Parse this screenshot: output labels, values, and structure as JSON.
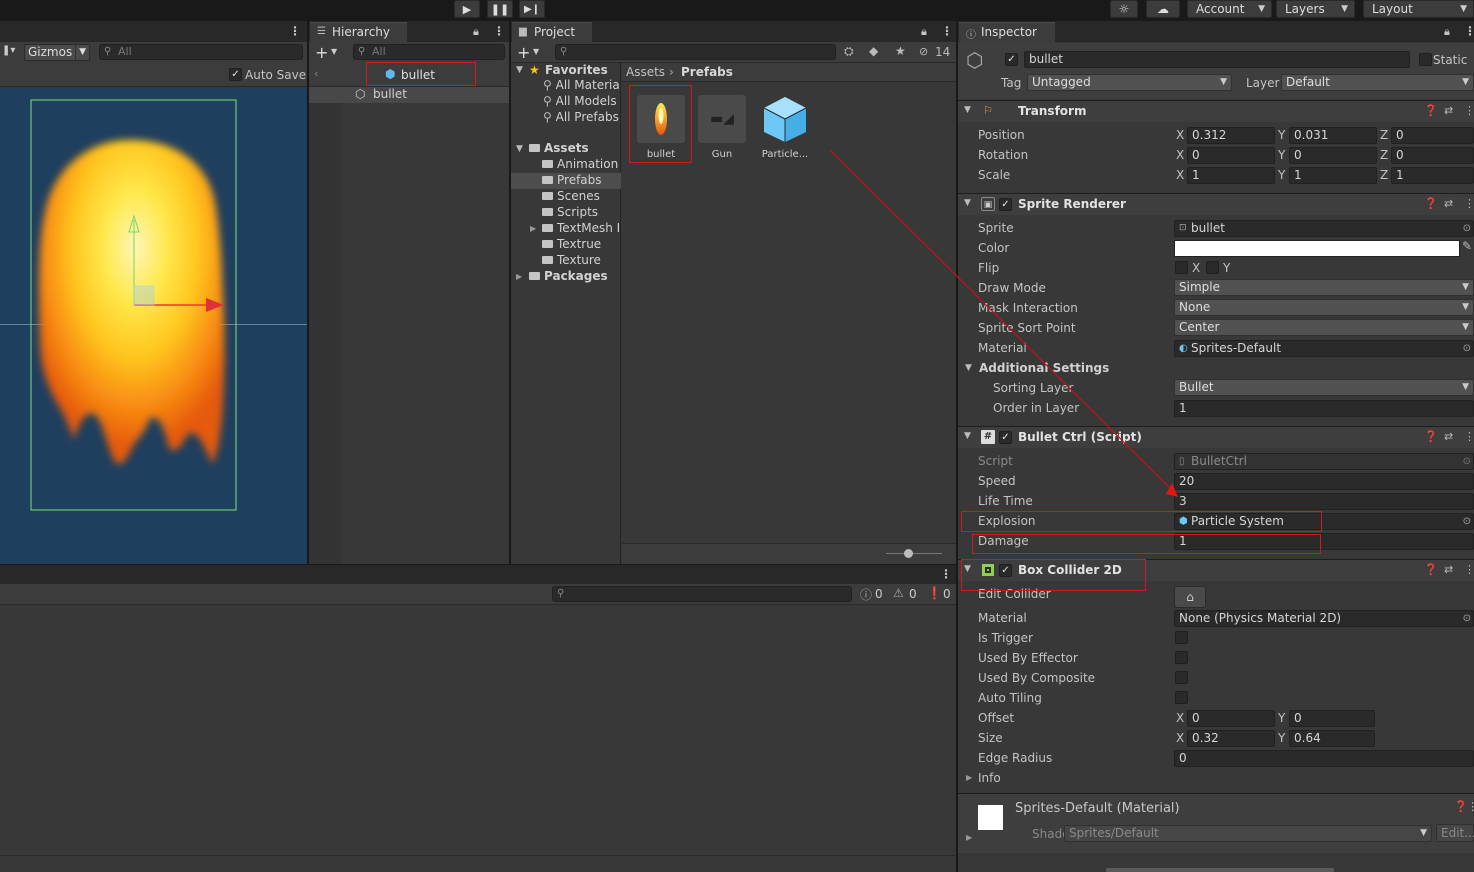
{
  "toolbar": {
    "play_icon": "play-icon",
    "pause_icon": "pause-icon",
    "step_icon": "step-icon",
    "account_label": "Account",
    "layers_label": "Layers",
    "layout_label": "Layout"
  },
  "scene": {
    "gizmos_label": "Gizmos",
    "search_placeholder": "All",
    "auto_save_label": "Auto Save"
  },
  "hierarchy": {
    "tab_label": "Hierarchy",
    "search_placeholder": "All",
    "prefab_header": "bullet",
    "items": [
      {
        "label": "bullet"
      }
    ]
  },
  "project": {
    "tab_label": "Project",
    "hidden_count": "14",
    "favorites_label": "Favorites",
    "favorites": [
      "All Materia",
      "All Models",
      "All Prefabs"
    ],
    "assets_label": "Assets",
    "folders": [
      "Animation",
      "Prefabs",
      "Scenes",
      "Scripts",
      "TextMesh I",
      "Textrue",
      "Texture"
    ],
    "packages_label": "Packages",
    "breadcrumb": [
      "Assets",
      "Prefabs"
    ],
    "assets": [
      {
        "name": "bullet"
      },
      {
        "name": "Gun"
      },
      {
        "name": "Particle..."
      }
    ]
  },
  "console": {
    "info_count": "0",
    "warn_count": "0",
    "error_count": "0"
  },
  "inspector": {
    "tab_label": "Inspector",
    "object_name": "bullet",
    "static_label": "Static",
    "tag_label": "Tag",
    "tag_value": "Untagged",
    "layer_label": "Layer",
    "layer_value": "Default",
    "transform": {
      "title": "Transform",
      "rows": [
        {
          "label": "Position",
          "x": "0.312",
          "y": "0.031",
          "z": "0"
        },
        {
          "label": "Rotation",
          "x": "0",
          "y": "0",
          "z": "0"
        },
        {
          "label": "Scale",
          "x": "1",
          "y": "1",
          "z": "1"
        }
      ]
    },
    "sprite_renderer": {
      "title": "Sprite Renderer",
      "sprite_label": "Sprite",
      "sprite_value": "bullet",
      "color_label": "Color",
      "flip_label": "Flip",
      "flip_x": "X",
      "flip_y": "Y",
      "draw_mode_label": "Draw Mode",
      "draw_mode_value": "Simple",
      "mask_label": "Mask Interaction",
      "mask_value": "None",
      "sort_point_label": "Sprite Sort Point",
      "sort_point_value": "Center",
      "material_label": "Material",
      "material_value": "Sprites-Default",
      "additional_label": "Additional Settings",
      "sorting_layer_label": "Sorting Layer",
      "sorting_layer_value": "Bullet",
      "order_label": "Order in Layer",
      "order_value": "1"
    },
    "bullet_ctrl": {
      "title": "Bullet Ctrl (Script)",
      "script_label": "Script",
      "script_value": "BulletCtrl",
      "speed_label": "Speed",
      "speed_value": "20",
      "life_label": "Life Time",
      "life_value": "3",
      "explosion_label": "Explosion",
      "explosion_value": "Particle System",
      "damage_label": "Damage",
      "damage_value": "1"
    },
    "box_collider": {
      "title": "Box Collider 2D",
      "edit_label": "Edit Collider",
      "material_label": "Material",
      "material_value": "None (Physics Material 2D)",
      "trigger_label": "Is Trigger",
      "effector_label": "Used By Effector",
      "composite_label": "Used By Composite",
      "tiling_label": "Auto Tiling",
      "offset_label": "Offset",
      "offset_x": "0",
      "offset_y": "0",
      "size_label": "Size",
      "size_x": "0.32",
      "size_y": "0.64",
      "edge_label": "Edge Radius",
      "edge_value": "0",
      "info_label": "Info"
    },
    "material": {
      "title": "Sprites-Default (Material)",
      "shader_label": "Shader",
      "shader_value": "Sprites/Default",
      "edit_label": "Edit..."
    }
  },
  "colors": {
    "highlight": "#d11b1b",
    "scene_bg": "#1f3f5f",
    "fire_core": "#fff15a",
    "fire_edge": "#f36f10"
  }
}
